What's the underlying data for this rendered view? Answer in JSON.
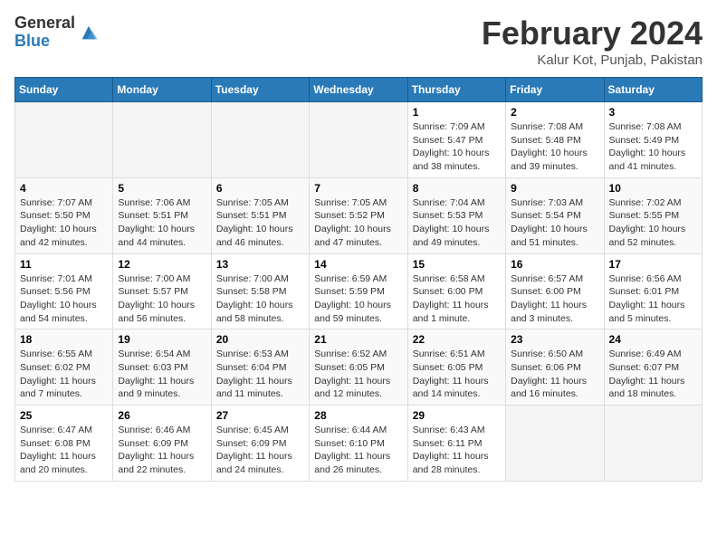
{
  "logo": {
    "general": "General",
    "blue": "Blue"
  },
  "title": {
    "month_year": "February 2024",
    "location": "Kalur Kot, Punjab, Pakistan"
  },
  "days_of_week": [
    "Sunday",
    "Monday",
    "Tuesday",
    "Wednesday",
    "Thursday",
    "Friday",
    "Saturday"
  ],
  "weeks": [
    [
      {
        "day": "",
        "info": ""
      },
      {
        "day": "",
        "info": ""
      },
      {
        "day": "",
        "info": ""
      },
      {
        "day": "",
        "info": ""
      },
      {
        "day": "1",
        "info": "Sunrise: 7:09 AM\nSunset: 5:47 PM\nDaylight: 10 hours\nand 38 minutes."
      },
      {
        "day": "2",
        "info": "Sunrise: 7:08 AM\nSunset: 5:48 PM\nDaylight: 10 hours\nand 39 minutes."
      },
      {
        "day": "3",
        "info": "Sunrise: 7:08 AM\nSunset: 5:49 PM\nDaylight: 10 hours\nand 41 minutes."
      }
    ],
    [
      {
        "day": "4",
        "info": "Sunrise: 7:07 AM\nSunset: 5:50 PM\nDaylight: 10 hours\nand 42 minutes."
      },
      {
        "day": "5",
        "info": "Sunrise: 7:06 AM\nSunset: 5:51 PM\nDaylight: 10 hours\nand 44 minutes."
      },
      {
        "day": "6",
        "info": "Sunrise: 7:05 AM\nSunset: 5:51 PM\nDaylight: 10 hours\nand 46 minutes."
      },
      {
        "day": "7",
        "info": "Sunrise: 7:05 AM\nSunset: 5:52 PM\nDaylight: 10 hours\nand 47 minutes."
      },
      {
        "day": "8",
        "info": "Sunrise: 7:04 AM\nSunset: 5:53 PM\nDaylight: 10 hours\nand 49 minutes."
      },
      {
        "day": "9",
        "info": "Sunrise: 7:03 AM\nSunset: 5:54 PM\nDaylight: 10 hours\nand 51 minutes."
      },
      {
        "day": "10",
        "info": "Sunrise: 7:02 AM\nSunset: 5:55 PM\nDaylight: 10 hours\nand 52 minutes."
      }
    ],
    [
      {
        "day": "11",
        "info": "Sunrise: 7:01 AM\nSunset: 5:56 PM\nDaylight: 10 hours\nand 54 minutes."
      },
      {
        "day": "12",
        "info": "Sunrise: 7:00 AM\nSunset: 5:57 PM\nDaylight: 10 hours\nand 56 minutes."
      },
      {
        "day": "13",
        "info": "Sunrise: 7:00 AM\nSunset: 5:58 PM\nDaylight: 10 hours\nand 58 minutes."
      },
      {
        "day": "14",
        "info": "Sunrise: 6:59 AM\nSunset: 5:59 PM\nDaylight: 10 hours\nand 59 minutes."
      },
      {
        "day": "15",
        "info": "Sunrise: 6:58 AM\nSunset: 6:00 PM\nDaylight: 11 hours\nand 1 minute."
      },
      {
        "day": "16",
        "info": "Sunrise: 6:57 AM\nSunset: 6:00 PM\nDaylight: 11 hours\nand 3 minutes."
      },
      {
        "day": "17",
        "info": "Sunrise: 6:56 AM\nSunset: 6:01 PM\nDaylight: 11 hours\nand 5 minutes."
      }
    ],
    [
      {
        "day": "18",
        "info": "Sunrise: 6:55 AM\nSunset: 6:02 PM\nDaylight: 11 hours\nand 7 minutes."
      },
      {
        "day": "19",
        "info": "Sunrise: 6:54 AM\nSunset: 6:03 PM\nDaylight: 11 hours\nand 9 minutes."
      },
      {
        "day": "20",
        "info": "Sunrise: 6:53 AM\nSunset: 6:04 PM\nDaylight: 11 hours\nand 11 minutes."
      },
      {
        "day": "21",
        "info": "Sunrise: 6:52 AM\nSunset: 6:05 PM\nDaylight: 11 hours\nand 12 minutes."
      },
      {
        "day": "22",
        "info": "Sunrise: 6:51 AM\nSunset: 6:05 PM\nDaylight: 11 hours\nand 14 minutes."
      },
      {
        "day": "23",
        "info": "Sunrise: 6:50 AM\nSunset: 6:06 PM\nDaylight: 11 hours\nand 16 minutes."
      },
      {
        "day": "24",
        "info": "Sunrise: 6:49 AM\nSunset: 6:07 PM\nDaylight: 11 hours\nand 18 minutes."
      }
    ],
    [
      {
        "day": "25",
        "info": "Sunrise: 6:47 AM\nSunset: 6:08 PM\nDaylight: 11 hours\nand 20 minutes."
      },
      {
        "day": "26",
        "info": "Sunrise: 6:46 AM\nSunset: 6:09 PM\nDaylight: 11 hours\nand 22 minutes."
      },
      {
        "day": "27",
        "info": "Sunrise: 6:45 AM\nSunset: 6:09 PM\nDaylight: 11 hours\nand 24 minutes."
      },
      {
        "day": "28",
        "info": "Sunrise: 6:44 AM\nSunset: 6:10 PM\nDaylight: 11 hours\nand 26 minutes."
      },
      {
        "day": "29",
        "info": "Sunrise: 6:43 AM\nSunset: 6:11 PM\nDaylight: 11 hours\nand 28 minutes."
      },
      {
        "day": "",
        "info": ""
      },
      {
        "day": "",
        "info": ""
      }
    ]
  ]
}
